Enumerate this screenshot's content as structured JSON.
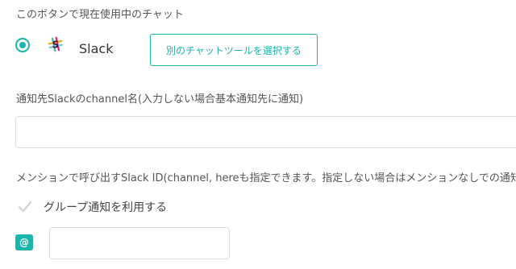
{
  "colors": {
    "accent": "#1ab5ad",
    "label_text": "#555555",
    "border": "#dcdcdc"
  },
  "current_chat": {
    "label": "このボタンで現在使用中のチャット",
    "selected": true,
    "service_name": "Slack",
    "service_icon": "slack-logo-icon",
    "select_button_label": "別のチャットツールを選択する"
  },
  "channel": {
    "label": "通知先Slackのchannel名(入力しない場合基本通知先に通知)",
    "value": "",
    "placeholder": ""
  },
  "mention": {
    "label": "メンションで呼び出すSlack ID(channel, hereも指定できます。指定しない場合はメンションなしでの通知)",
    "group_checkbox_label": "グループ通知を利用する",
    "group_checked": false,
    "at_symbol": "@",
    "value": "",
    "placeholder": ""
  }
}
